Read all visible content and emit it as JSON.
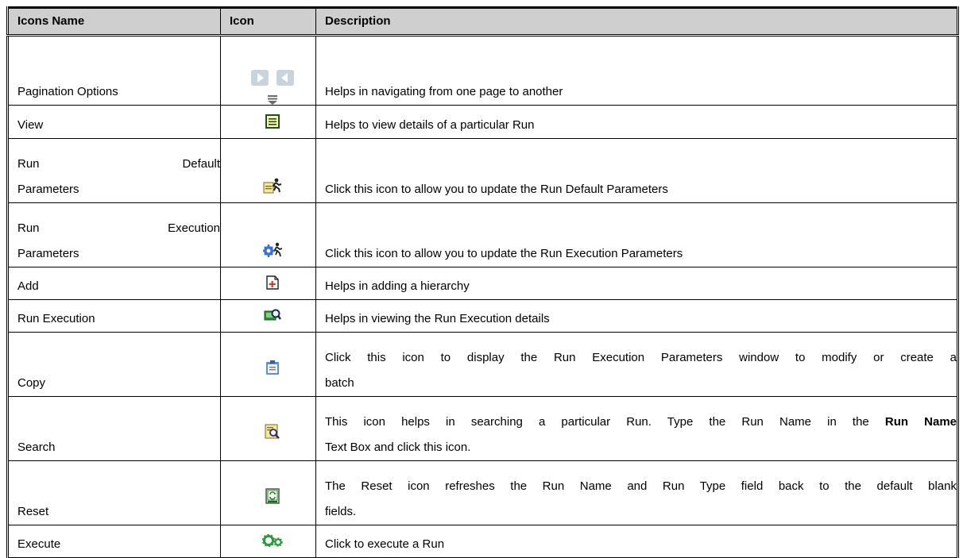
{
  "table": {
    "headers": [
      "Icons Name",
      "Icon",
      "Description"
    ],
    "rows": [
      {
        "name": "Pagination Options",
        "icon": "pagination-arrows-icon",
        "description": "Helps in navigating from one page to another"
      },
      {
        "name": "View",
        "icon": "view-details-icon",
        "description": "Helps to view details of a particular Run"
      },
      {
        "name_line1_left": "Run",
        "name_line1_right": "Default",
        "name_line2": "Parameters",
        "icon": "run-default-parameters-icon",
        "description": "Click this icon to allow you to update the Run Default Parameters"
      },
      {
        "name_line1_left": "Run",
        "name_line1_right": "Execution",
        "name_line2": "Parameters",
        "icon": "run-execution-parameters-icon",
        "description": "Click this icon to allow you to update the Run Execution Parameters"
      },
      {
        "name": "Add",
        "icon": "add-icon",
        "description": "Helps in adding a hierarchy"
      },
      {
        "name": "Run Execution",
        "icon": "run-execution-icon",
        "description": "Helps in viewing the Run Execution details"
      },
      {
        "name": "Copy",
        "icon": "copy-icon",
        "description_line1": "Click this icon to display the Run Execution Parameters window to modify or create a",
        "description_line2": "batch"
      },
      {
        "name": "Search",
        "icon": "search-icon",
        "description_line1_pre": "This icon helps in searching a particular Run. Type the Run Name in the ",
        "description_line1_bold": "Run Name",
        "description_line2": "Text Box and click this icon."
      },
      {
        "name": "Reset",
        "icon": "reset-icon",
        "description_line1": "The Reset icon refreshes the Run Name and Run Type field back to the default blank",
        "description_line2": "fields."
      },
      {
        "name": "Execute",
        "icon": "execute-icon",
        "description": "Click to execute a Run"
      }
    ]
  },
  "colors": {
    "header_bg": "#cfcfcf",
    "border": "#000000"
  }
}
